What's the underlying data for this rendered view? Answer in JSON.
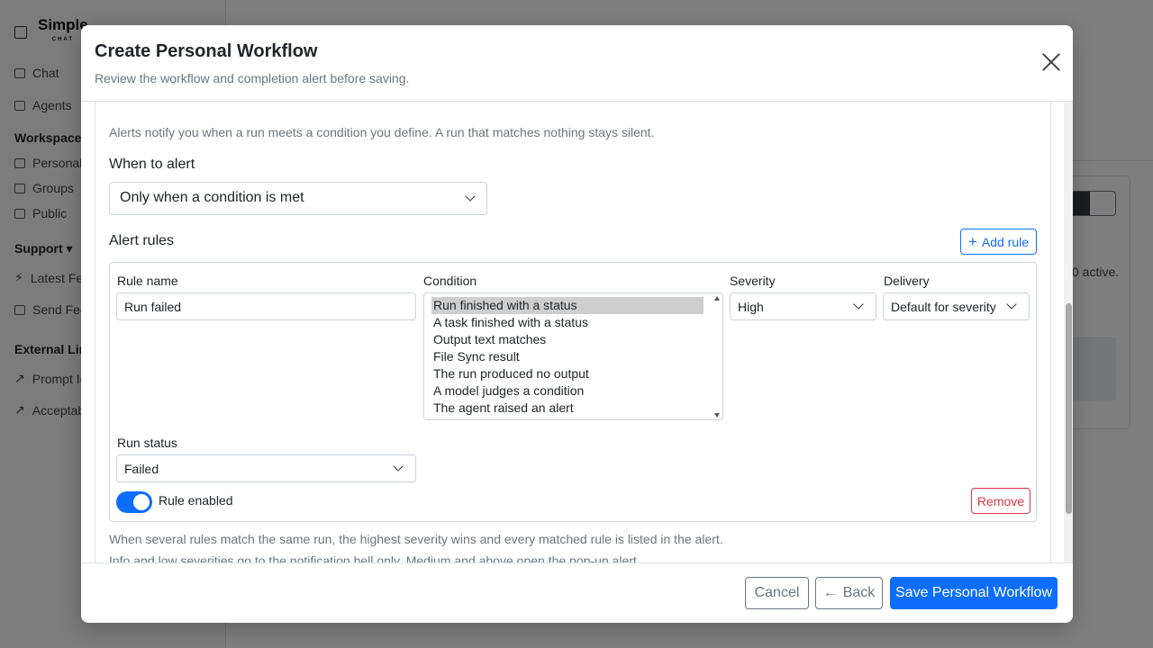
{
  "background": {
    "brand": {
      "name": "Simple",
      "tag": "CHAT"
    },
    "nav": {
      "chat": "Chat",
      "agents": "Agents"
    },
    "workspaces": {
      "heading": "Workspaces",
      "items": [
        "Personal",
        "Groups",
        "Public"
      ]
    },
    "support": {
      "heading": "Support",
      "items": [
        "Latest Fea",
        "Send Feed"
      ]
    },
    "external": {
      "heading": "External Lin",
      "items": [
        "Prompt Id",
        "Acceptab"
      ]
    },
    "active_text": "0 active."
  },
  "modal": {
    "title": "Create Personal Workflow",
    "subtitle": "Review the workflow and completion alert before saving.",
    "intro": "Alerts notify you when a run meets a condition you define. A run that matches nothing stays silent.",
    "when_to_alert": {
      "label": "When to alert",
      "value": "Only when a condition is met"
    },
    "alert_rules": {
      "label": "Alert rules",
      "add_label": "Add rule"
    },
    "rule": {
      "name_label": "Rule name",
      "name_value": "Run failed",
      "condition_label": "Condition",
      "conditions": [
        "Run finished with a status",
        "A task finished with a status",
        "Output text matches",
        "File Sync result",
        "The run produced no output",
        "A model judges a condition",
        "The agent raised an alert"
      ],
      "selected_condition": "Run finished with a status",
      "severity_label": "Severity",
      "severity_value": "High",
      "delivery_label": "Delivery",
      "delivery_value": "Default for severity",
      "run_status_label": "Run status",
      "run_status_value": "Failed",
      "enabled_label": "Rule enabled",
      "remove_label": "Remove"
    },
    "notes": [
      "When several rules match the same run, the highest severity wins and every matched rule is listed in the alert.",
      "Info and low severities go to the notification bell only. Medium and above open the pop-up alert."
    ],
    "footer": {
      "cancel": "Cancel",
      "back": "Back",
      "save": "Save Personal Workflow"
    }
  },
  "colors": {
    "primary": "#0d6efd",
    "danger": "#dc3545",
    "muted": "#6c757d",
    "border": "#ced4da"
  }
}
